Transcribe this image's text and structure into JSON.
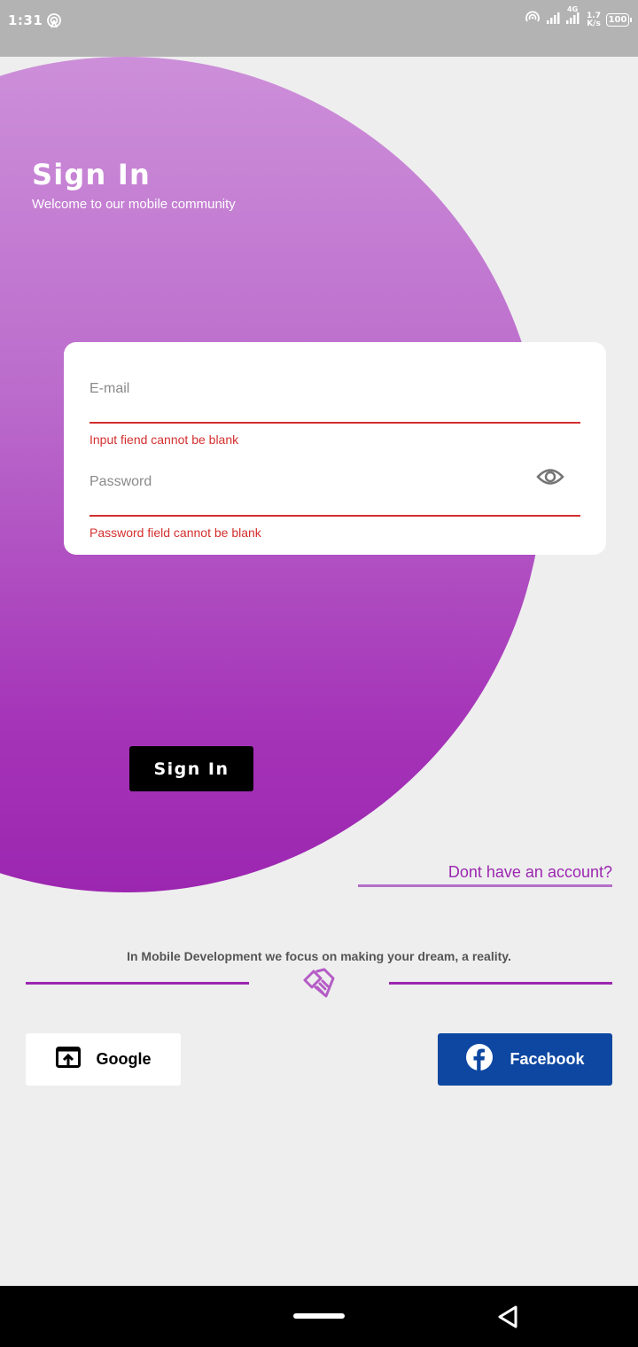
{
  "status_bar": {
    "time": "1:31",
    "network_type": "4G",
    "speed_value": "1.7",
    "speed_unit": "K/s",
    "battery": "100"
  },
  "header": {
    "title": "Sign In",
    "subtitle": "Welcome to our mobile community"
  },
  "form": {
    "email_placeholder": "E-mail",
    "email_error": "Input fiend cannot be blank",
    "password_placeholder": "Password",
    "password_error": "Password field cannot be blank"
  },
  "actions": {
    "signin_label": "Sign In",
    "no_account_label": "Dont have an account?"
  },
  "footer": {
    "tagline": "In Mobile Development we focus on making your dream, a reality.",
    "google_label": "Google",
    "facebook_label": "Facebook"
  },
  "colors": {
    "accent": "#9c27b0",
    "error": "#d32f2f",
    "facebook": "#0d47a1"
  }
}
